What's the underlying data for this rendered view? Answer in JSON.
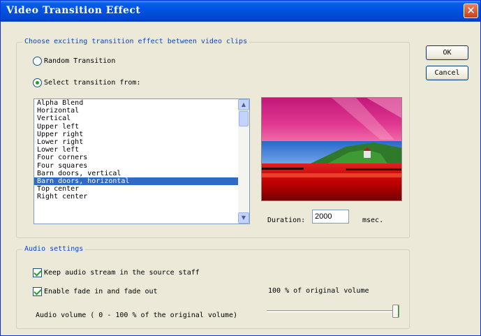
{
  "window": {
    "title": "Video Transition Effect",
    "close_glyph": "✕"
  },
  "transition_group": {
    "legend": "Choose exciting transition effect between video clips",
    "random_label": "Random Transition",
    "select_label": "Select transition from:",
    "selected_option": "select",
    "list_items": [
      "Alpha Blend",
      "Horizontal",
      "Vertical",
      "Upper left",
      "Upper right",
      "Lower right",
      "Lower left",
      "Four corners",
      "Four squares",
      "Barn doors, vertical",
      "Barn doors, horizontal",
      "Top center",
      "Right center"
    ],
    "selected_item": "Barn doors, horizontal",
    "duration_label": "Duration:",
    "duration_value": "2000",
    "duration_unit": "msec."
  },
  "buttons": {
    "ok": "OK",
    "cancel": "Cancel"
  },
  "audio_group": {
    "legend": "Audio settings",
    "keep_audio_label": "Keep audio stream in the source staff",
    "keep_audio_checked": true,
    "fade_label": "Enable fade in and fade out",
    "fade_checked": true,
    "volume_caption": "100 % of original volume",
    "volume_label": "Audio volume ( 0 - 100 % of the original volume)",
    "volume_percent": 100
  },
  "icons": {
    "close": "close-icon",
    "scroll_up": "chevron-up-icon",
    "scroll_down": "chevron-down-icon"
  },
  "colors": {
    "title_bar": "#0054e3",
    "selection": "#316ac5",
    "group_legend": "#0046d5",
    "dialog_bg": "#ece9d8"
  }
}
